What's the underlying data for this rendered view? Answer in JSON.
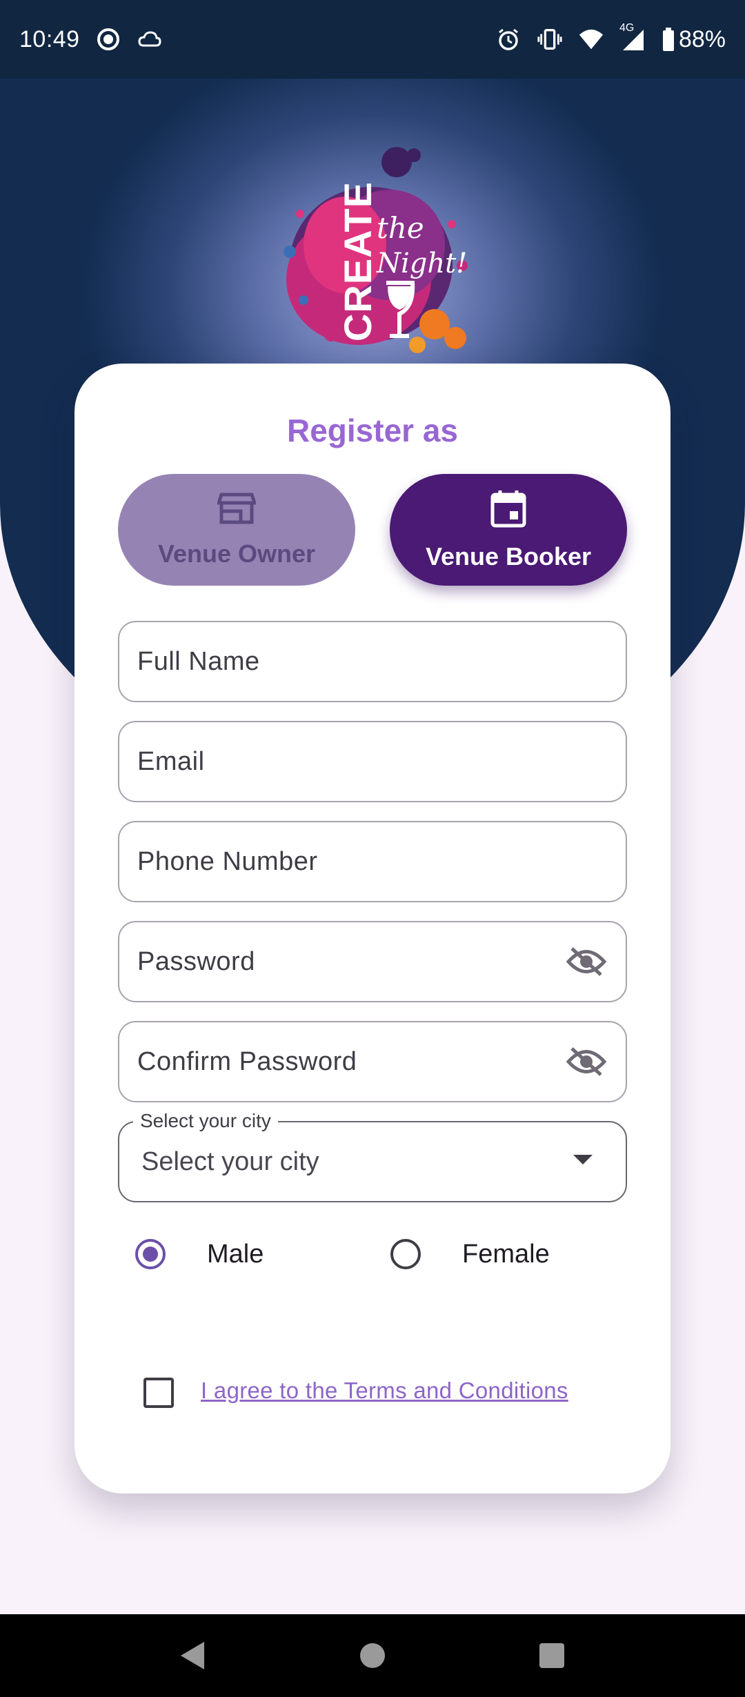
{
  "status_bar": {
    "time": "10:49",
    "network": "4G",
    "battery": "88%"
  },
  "app": {
    "logo_text": "CREATE the Night!"
  },
  "register": {
    "title": "Register as",
    "roles": [
      {
        "label": "Venue Owner",
        "icon": "store-icon",
        "selected": false
      },
      {
        "label": "Venue Booker",
        "icon": "calendar-icon",
        "selected": true
      }
    ]
  },
  "form": {
    "full_name_placeholder": "Full Name",
    "email_placeholder": "Email",
    "phone_placeholder": "Phone Number",
    "password_placeholder": "Password",
    "confirm_password_placeholder": "Confirm Password",
    "city_label": "Select your city",
    "city_value": "Select your city",
    "gender_options": [
      "Male",
      "Female"
    ],
    "gender_selected": "Male",
    "terms_label": "I agree to the Terms and Conditions",
    "terms_checked": false
  },
  "colors": {
    "accent": "#9867d3",
    "booker_bg": "#4a1a74",
    "owner_bg": "#9584b3",
    "hero_dark": "#132c50"
  }
}
